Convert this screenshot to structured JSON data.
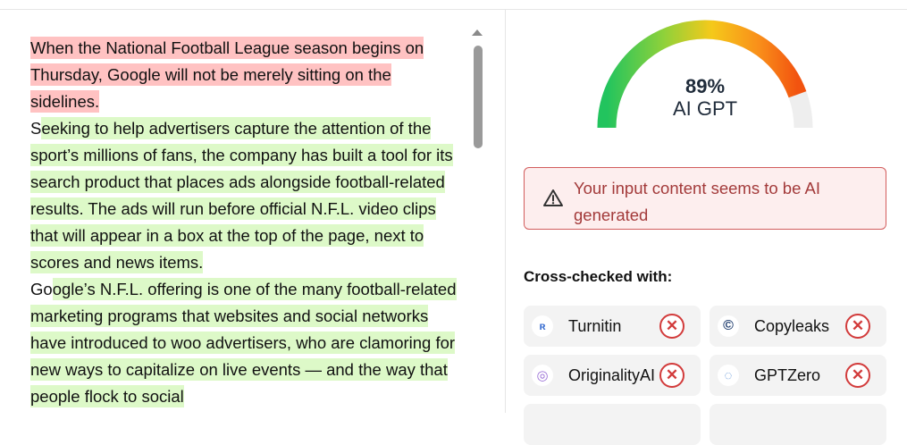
{
  "document": {
    "paragraphs": [
      [
        {
          "text": "When the National Football League season begins on Thursday, Google will not be merely sitting on the sidelines.",
          "class": "ai"
        }
      ],
      [
        {
          "text": "S",
          "class": "plain"
        },
        {
          "text": "eeking to help advertisers capture the attention of the sport’s millions of fans, the company has built a tool for its search product that places ads alongside football-related results. The ads will run before official N.F.L. video clips that will appear in a box at the top of the page, next to scores and news items.",
          "class": "human"
        }
      ],
      [
        {
          "text": "Go",
          "class": "plain"
        },
        {
          "text": "ogle’s N.F.L. offering is one of the many football-related marketing programs that websites and social networks have introduced to woo advertisers, who are clamoring for new ways to capitalize on live events — and the way that people flock to social",
          "class": "human"
        }
      ]
    ]
  },
  "result": {
    "percent": "89%",
    "label": "AI GPT",
    "percent_value": 89,
    "alert_text": "Your input content seems to be AI generated"
  },
  "crosscheck": {
    "title": "Cross-checked with:",
    "services": [
      {
        "name": "Turnitin",
        "icon": "turnitin-icon",
        "status": "failed"
      },
      {
        "name": "Copyleaks",
        "icon": "copyleaks-icon",
        "status": "failed"
      },
      {
        "name": "OriginalityAI",
        "icon": "originality-icon",
        "status": "failed"
      },
      {
        "name": "GPTZero",
        "icon": "gptzero-icon",
        "status": "failed"
      }
    ]
  },
  "colors": {
    "ai_highlight": "#ffc2c2",
    "human_highlight": "#ddf9c8",
    "alert_red": "#d25c5c",
    "fail_red": "#d23b3b"
  }
}
